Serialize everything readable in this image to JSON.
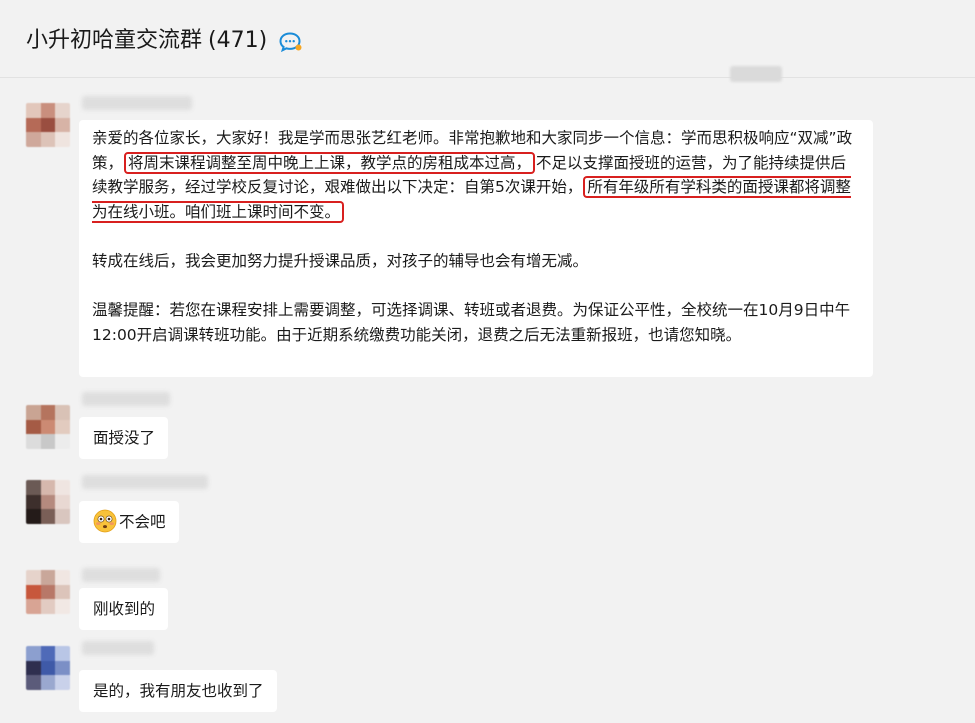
{
  "header": {
    "group_name": "小升初哈童交流群",
    "member_count": "(471)",
    "icon": "chat-bubble-icon"
  },
  "colors": {
    "background": "#f2f2f2",
    "bubble": "#ffffff",
    "highlight_box": "#d8201f",
    "header_icon": "#1a8cd8"
  },
  "messages": [
    {
      "paragraphs": [
        {
          "t1": "亲爱的各位家长，大家好！我是学而思张艺红老师。非常抱歉地和大家同步一个信息：学而思积极响应“双减”政策，",
          "h1": "将周末课程调整至周中晚上上课，教学点的房租成本过高，",
          "t2": "不足以支撑面授班的运营，为了能持续提供后续教学服务，经过学校反复讨论，艰难做出以下决定：自第5次课开始，",
          "h2": "所有年级所有学科类的面授课都将调整为在线小班。咱们班上课时间不变。"
        },
        "转成在线后，我会更加努力提升授课品质，对孩子的辅导也会有增无减。",
        "温馨提醒：若您在课程安排上需要调整，可选择调课、转班或者退费。为保证公平性，全校统一在10月9日中午12:00开启调课转班功能。由于近期系统缴费功能关闭，退费之后无法重新报班，也请您知晓。"
      ]
    },
    {
      "text": "面授没了"
    },
    {
      "emoji": "flushed-face-icon",
      "text": "不会吧"
    },
    {
      "text": "刚收到的"
    },
    {
      "text": "是的，我有朋友也收到了"
    }
  ]
}
